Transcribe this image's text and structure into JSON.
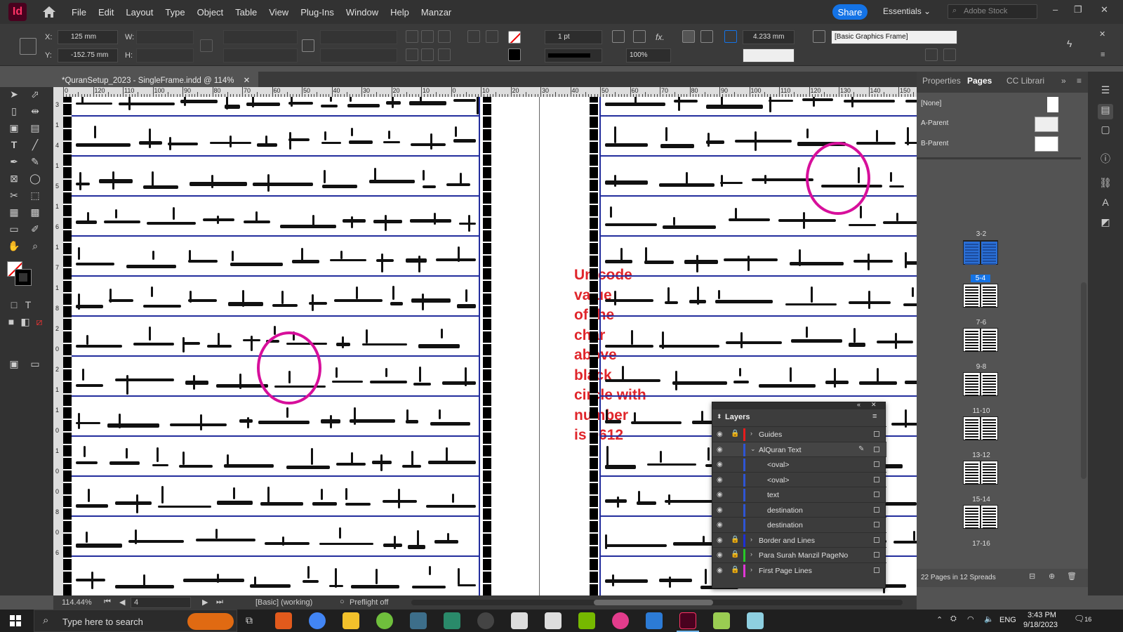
{
  "app": {
    "logo": "Id",
    "menu": [
      "File",
      "Edit",
      "Layout",
      "Type",
      "Object",
      "Table",
      "View",
      "Plug-Ins",
      "Window",
      "Help",
      "Manzar"
    ],
    "share_label": "Share",
    "workspace": "Essentials",
    "search_placeholder": "Adobe Stock"
  },
  "control_panel": {
    "x_label": "X:",
    "x_value": "125 mm",
    "y_label": "Y:",
    "y_value": "-152.75 mm",
    "w_label": "W:",
    "h_label": "H:",
    "stroke_weight": "1 pt",
    "opacity": "100%",
    "spacing": "4.233 mm",
    "object_style": "[Basic Graphics Frame]",
    "fx_label": "fx."
  },
  "document": {
    "tab_title": "*QuranSetup_2023 - SingleFrame.indd @ 114%",
    "ruler_ticks": [
      "0",
      "120",
      "110",
      "100",
      "90",
      "80",
      "70",
      "60",
      "50",
      "40",
      "30",
      "20",
      "10",
      "0",
      "10",
      "20",
      "30",
      "40",
      "50",
      "60",
      "70",
      "80",
      "90",
      "100",
      "110",
      "120",
      "130",
      "140",
      "150"
    ],
    "vertical_ruler_ticks": [
      "3",
      "1",
      "4",
      "1",
      "5",
      "1",
      "6",
      "1",
      "7",
      "1",
      "8",
      "2",
      "0",
      "2",
      "1",
      "1",
      "0",
      "1",
      "0",
      "0",
      "8",
      "0",
      "6"
    ],
    "annotation": [
      "Unicode",
      "value",
      "of the",
      "char",
      "above",
      "black",
      "circle with",
      "number",
      "is 0612"
    ]
  },
  "status": {
    "zoom": "114.44%",
    "page": "4",
    "preflight_profile": "[Basic] (working)",
    "preflight": "Preflight off"
  },
  "pages_panel": {
    "tabs": [
      "Properties",
      "Pages",
      "CC Librari"
    ],
    "masters": [
      "[None]",
      "A-Parent",
      "B-Parent"
    ],
    "spread_labels": [
      "3-2",
      "5-4",
      "7-6",
      "9-8",
      "11-10",
      "13-12",
      "15-14",
      "17-16"
    ],
    "footer": "22 Pages in 12 Spreads"
  },
  "layers_panel": {
    "title": "Layers",
    "rows": [
      {
        "name": "Guides",
        "color": "#e81c1c",
        "locked": true,
        "expanded": false,
        "indent": 0
      },
      {
        "name": "AlQuran Text",
        "color": "#2e55d4",
        "locked": false,
        "expanded": true,
        "indent": 0
      },
      {
        "name": "<oval>",
        "color": "#2e55d4",
        "locked": false,
        "expanded": false,
        "indent": 1
      },
      {
        "name": "<oval>",
        "color": "#2e55d4",
        "locked": false,
        "expanded": false,
        "indent": 1
      },
      {
        "name": "text",
        "color": "#2e55d4",
        "locked": false,
        "expanded": false,
        "indent": 1
      },
      {
        "name": "destination",
        "color": "#2e55d4",
        "locked": false,
        "expanded": false,
        "indent": 1
      },
      {
        "name": "destination",
        "color": "#2e55d4",
        "locked": false,
        "expanded": false,
        "indent": 1
      },
      {
        "name": "Border and Lines",
        "color": "#1d2fd6",
        "locked": true,
        "expanded": false,
        "indent": 0
      },
      {
        "name": "Para Surah Manzil PageNo",
        "color": "#28c828",
        "locked": true,
        "expanded": false,
        "indent": 0
      },
      {
        "name": "First Page Lines",
        "color": "#e038d6",
        "locked": true,
        "expanded": false,
        "indent": 0
      }
    ]
  },
  "taskbar": {
    "search_placeholder": "Type here to search",
    "time": "3:43 PM",
    "date": "9/18/2023",
    "lang": "ENG",
    "notifications": "16"
  },
  "colors": {
    "accent": "#1473e6",
    "annotation": "#e0262b",
    "circle": "#d70f9b",
    "page_lines": "#232e9d"
  }
}
